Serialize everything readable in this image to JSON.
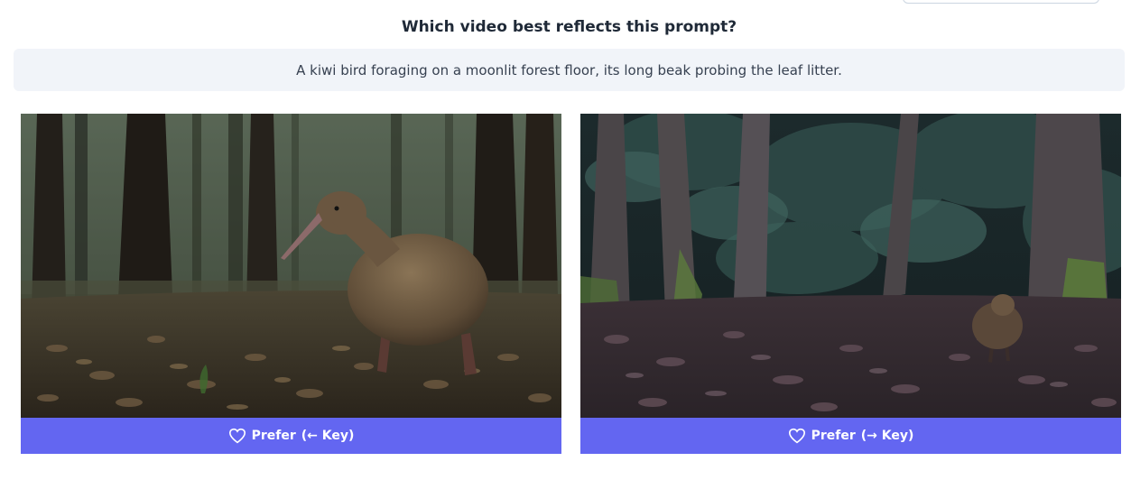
{
  "question": "Which video best reflects this prompt?",
  "prompt_text": "A kiwi bird foraging on a moonlit forest floor, its long beak probing the leaf litter.",
  "videos": [
    {
      "button_label": "Prefer",
      "key_hint": "(← Key)",
      "icon": "heart-outline-icon"
    },
    {
      "button_label": "Prefer",
      "key_hint": "(→ Key)",
      "icon": "heart-outline-icon"
    }
  ],
  "colors": {
    "accent": "#6366f1",
    "prompt_bg": "#f1f4f9",
    "text": "#1f2937"
  }
}
